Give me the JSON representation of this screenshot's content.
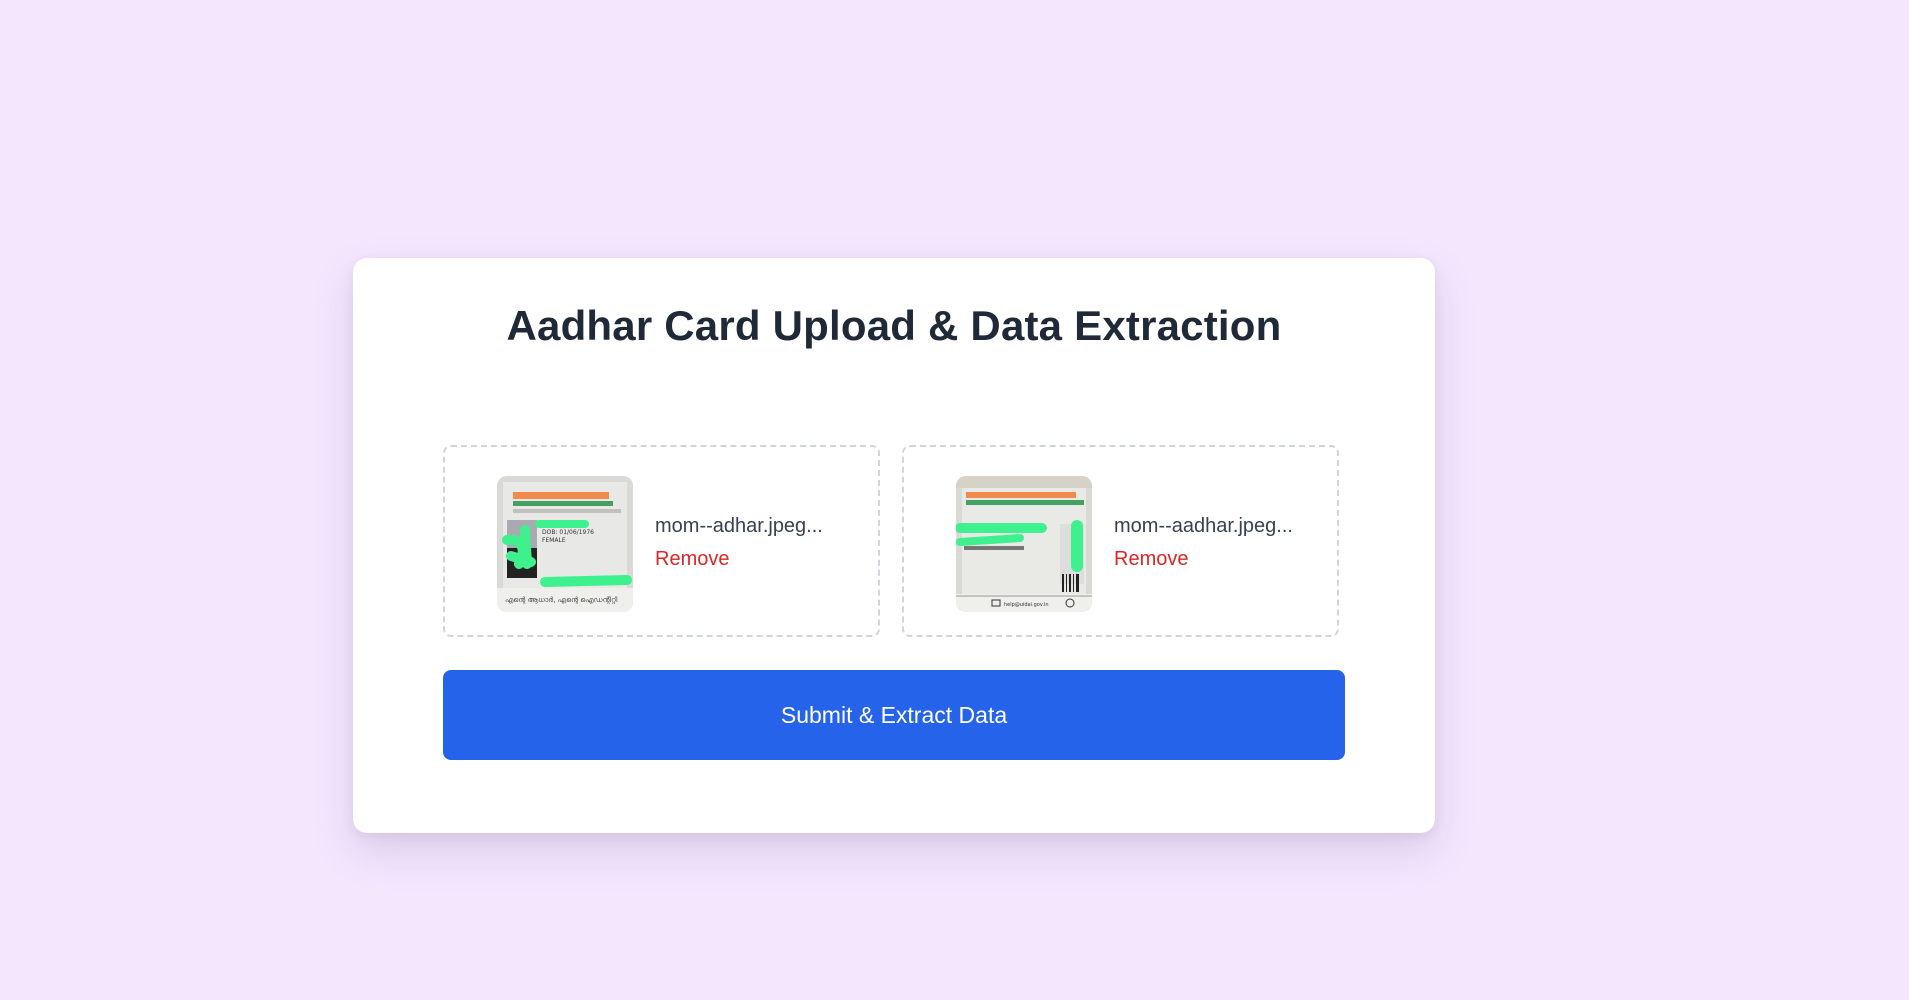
{
  "page": {
    "title": "Aadhar Card Upload & Data Extraction"
  },
  "uploads": [
    {
      "file_name": "mom--adhar.jpeg...",
      "remove_label": "Remove"
    },
    {
      "file_name": "mom--aadhar.jpeg...",
      "remove_label": "Remove"
    }
  ],
  "actions": {
    "submit_label": "Submit & Extract Data"
  },
  "colors": {
    "background": "#f3e6fd",
    "card": "#ffffff",
    "title": "#1f2937",
    "remove": "#dc2626",
    "primary_button": "#2563eb"
  }
}
